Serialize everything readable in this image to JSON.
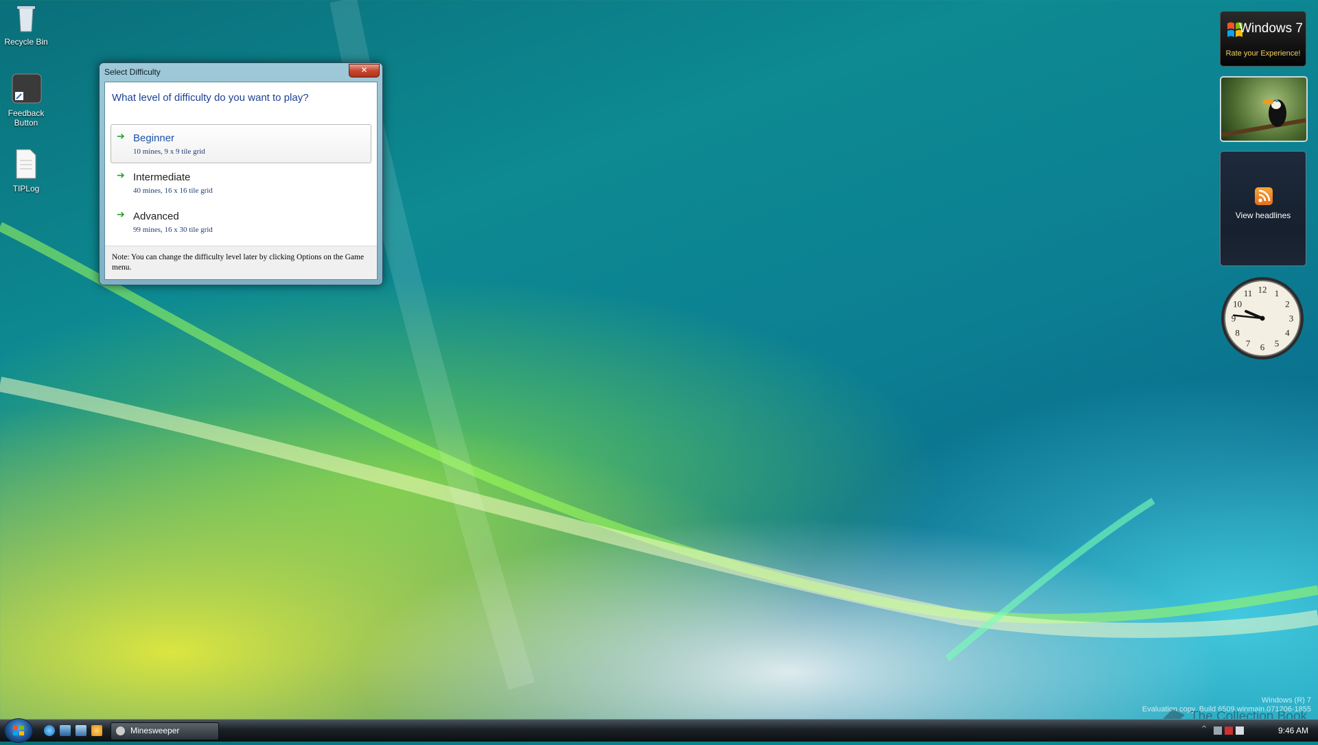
{
  "desktop": {
    "icons": [
      {
        "label": "Recycle Bin"
      },
      {
        "label": "Feedback Button"
      },
      {
        "label": "TIPLog"
      }
    ]
  },
  "dialog": {
    "title": "Select Difficulty",
    "close_symbol": "✕",
    "question": "What level of difficulty do you want to play?",
    "options": [
      {
        "label": "Beginner",
        "detail": "10 mines, 9 x 9 tile grid",
        "selected": true
      },
      {
        "label": "Intermediate",
        "detail": "40 mines, 16 x 16 tile grid",
        "selected": false
      },
      {
        "label": "Advanced",
        "detail": "99 mines, 16 x 30 tile grid",
        "selected": false
      }
    ],
    "arrow_glyph": "➔",
    "note": "Note: You can change the difficulty level later by clicking Options on the Game menu."
  },
  "gadgets": {
    "windows7": {
      "brand": "Windows 7",
      "subtitle": "Rate your Experience!"
    },
    "feed": {
      "label": "View headlines"
    },
    "clock": {
      "hour": 9,
      "minute": 46
    }
  },
  "taskbar": {
    "task_label": "Minesweeper",
    "time": "9:46 AM"
  },
  "watermark": {
    "line1": "Windows (R) 7",
    "line2": "Evaluation copy. Build 6509.winmain.071206-1855",
    "collection": "The Collection Book"
  },
  "colors": {
    "accent_blue": "#1c52a8",
    "arrow_green": "#1fa02a",
    "rate_yellow": "#f5d060"
  }
}
